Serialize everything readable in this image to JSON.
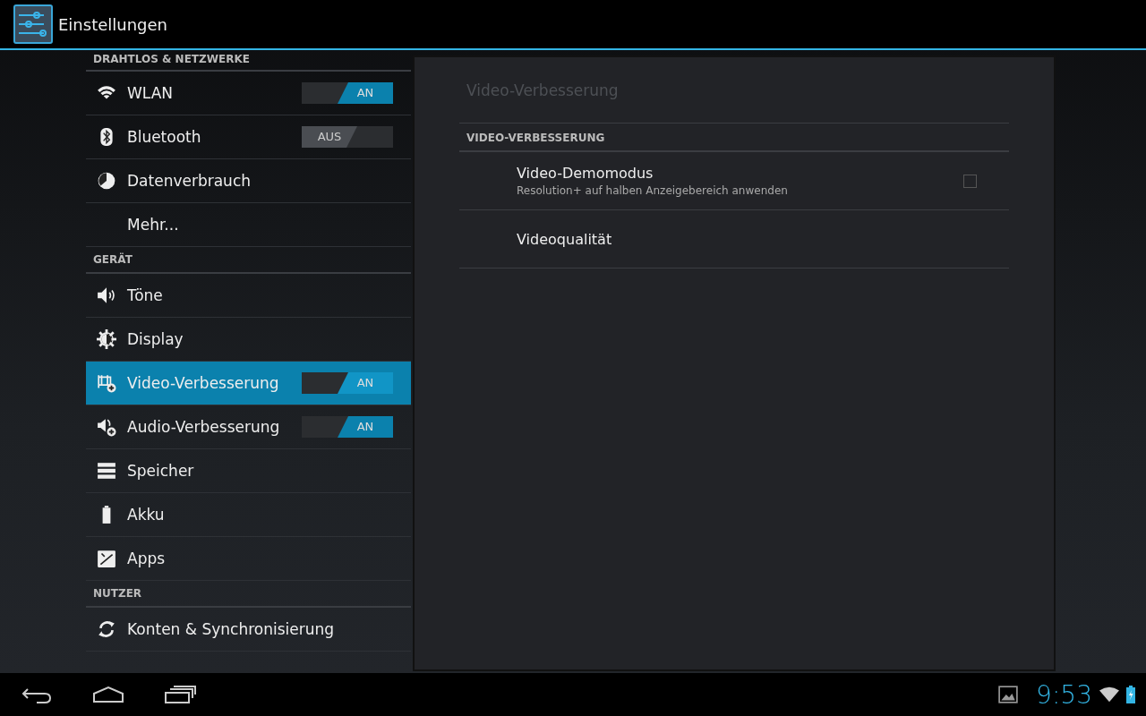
{
  "action_bar": {
    "title": "Einstellungen"
  },
  "sidebar": {
    "items": [
      {
        "kind": "header",
        "label": "DRAHTLOS & NETZWERKE"
      },
      {
        "kind": "toggle",
        "label": "WLAN",
        "selected": false,
        "toggle": {
          "on": true,
          "label": "AN"
        }
      },
      {
        "kind": "toggle",
        "label": "Bluetooth",
        "selected": false,
        "toggle": {
          "on": false,
          "label": "AUS"
        }
      },
      {
        "kind": "plain",
        "label": "Datenverbrauch",
        "selected": false
      },
      {
        "kind": "plain",
        "label": "Mehr...",
        "selected": false
      },
      {
        "kind": "header",
        "label": "GERÄT"
      },
      {
        "kind": "plain",
        "label": "Töne",
        "selected": false
      },
      {
        "kind": "plain",
        "label": "Display",
        "selected": false
      },
      {
        "kind": "toggle",
        "label": "Video-Verbesserung",
        "selected": true,
        "toggle": {
          "on": true,
          "label": "AN"
        }
      },
      {
        "kind": "toggle",
        "label": "Audio-Verbesserung",
        "selected": false,
        "toggle": {
          "on": true,
          "label": "AN"
        }
      },
      {
        "kind": "plain",
        "label": "Speicher",
        "selected": false
      },
      {
        "kind": "plain",
        "label": "Akku",
        "selected": false
      },
      {
        "kind": "plain",
        "label": "Apps",
        "selected": false
      },
      {
        "kind": "header",
        "label": "NUTZER"
      },
      {
        "kind": "plain",
        "label": "Konten & Synchronisierung",
        "selected": false
      }
    ]
  },
  "detail": {
    "title": "Video-Verbesserung",
    "section": "VIDEO-VERBESSERUNG",
    "items": [
      {
        "kind": "checkbox",
        "title": "Video-Demomodus",
        "summary": "Resolution+ auf halben Anzeigebereich anwenden",
        "checked": false
      },
      {
        "kind": "plain",
        "title": "Videoqualität"
      }
    ]
  },
  "system_bar": {
    "clock": "9:53"
  }
}
